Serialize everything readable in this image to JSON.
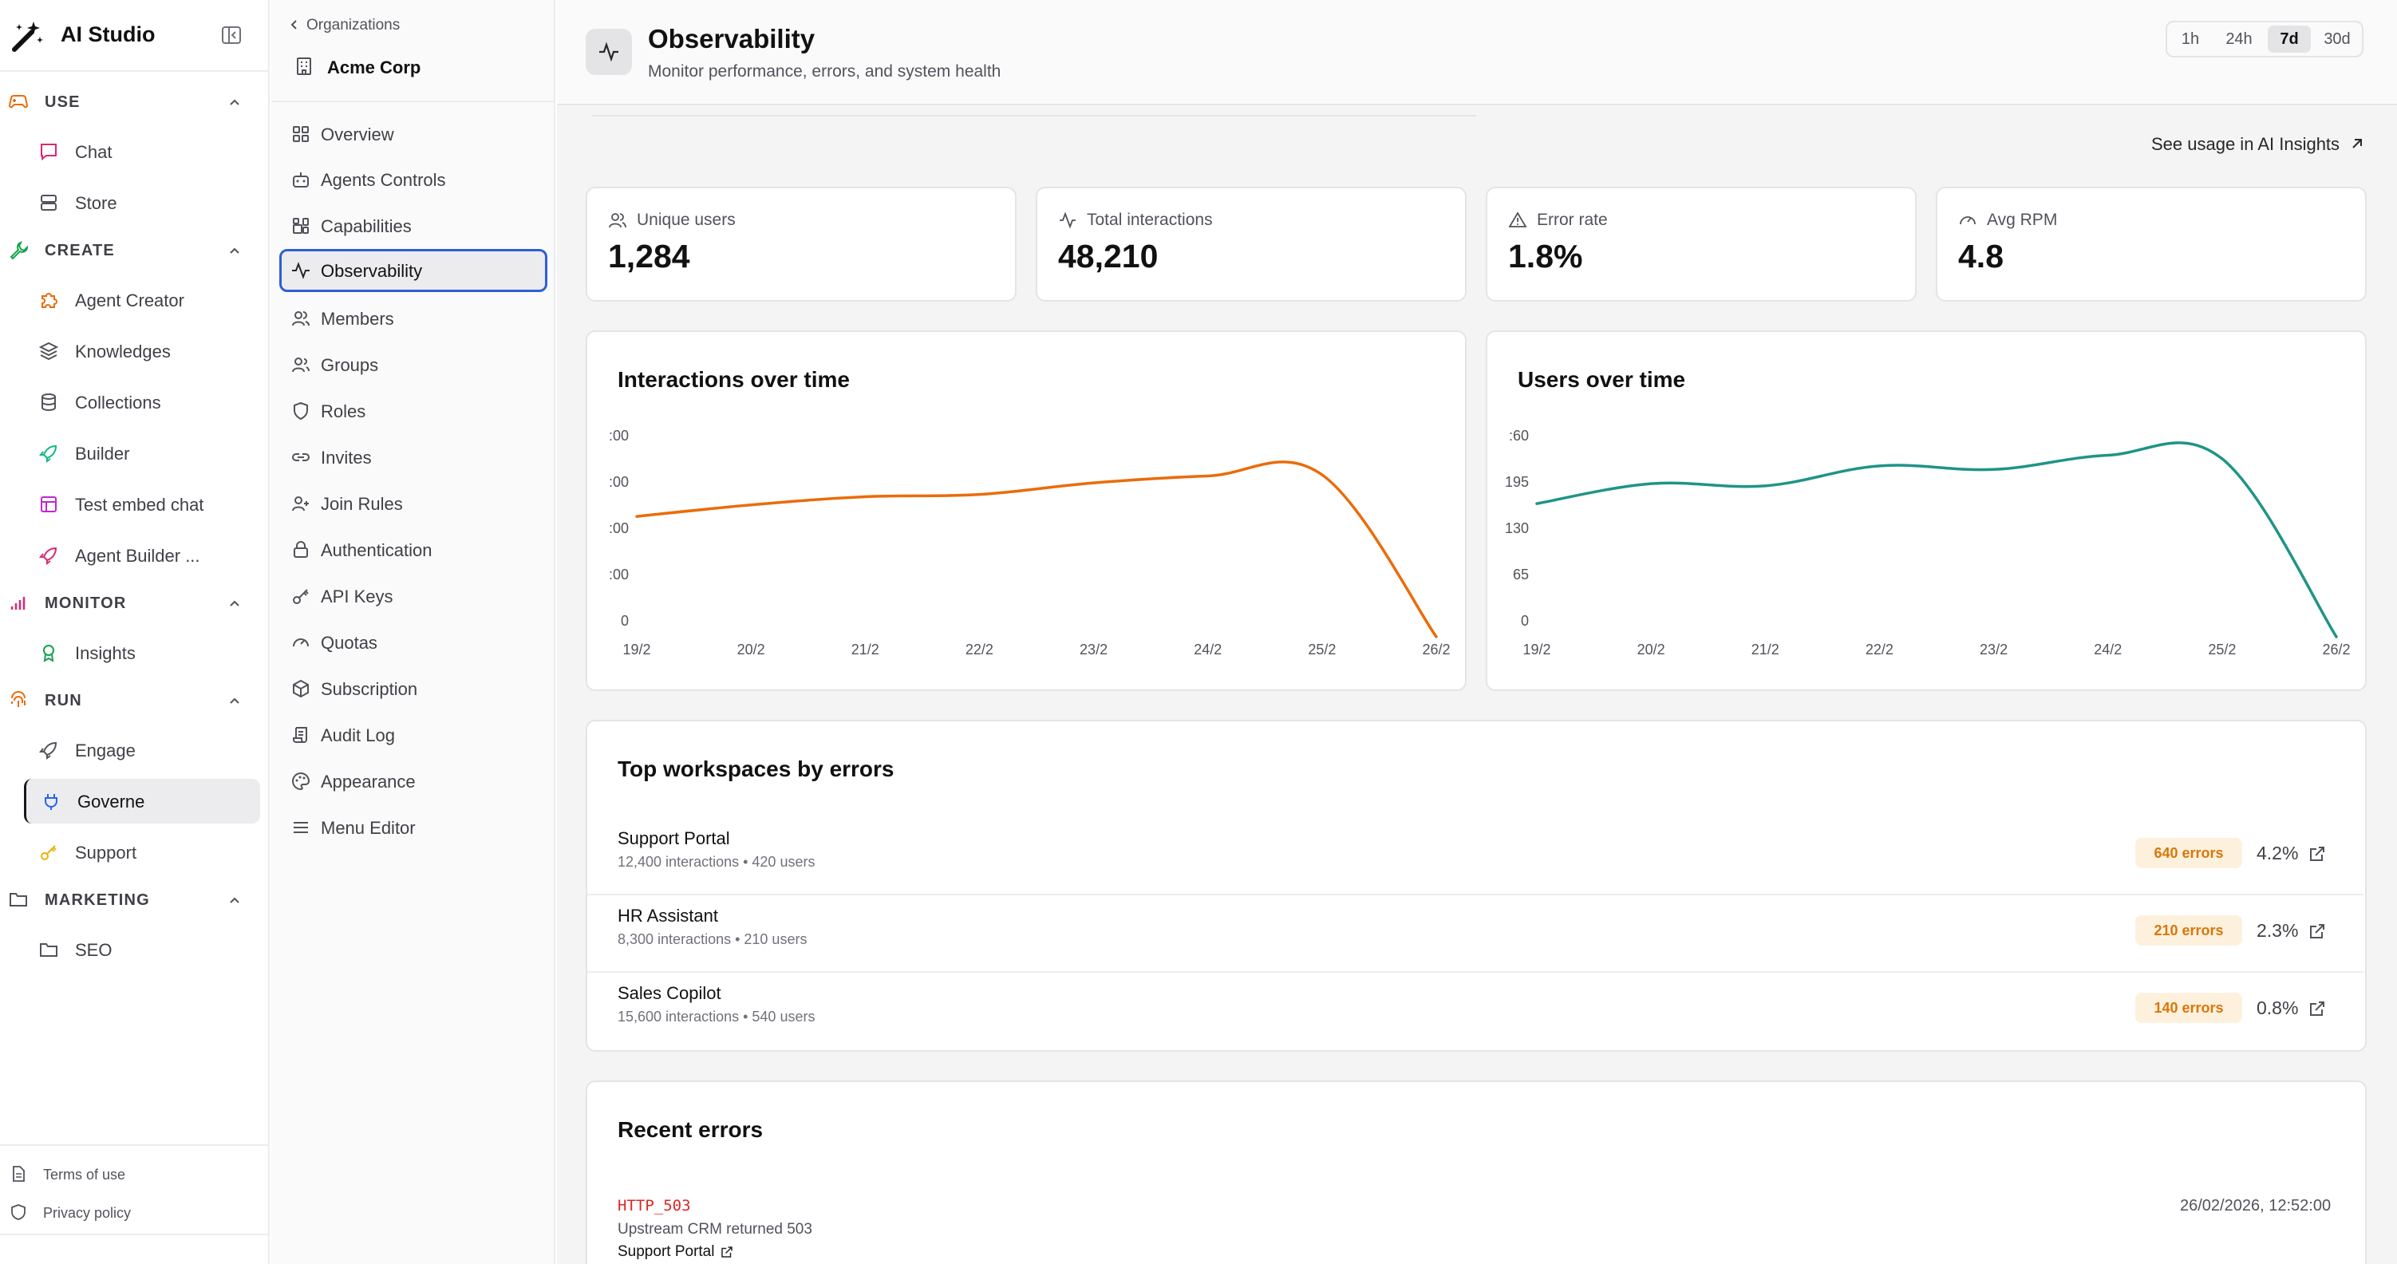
{
  "app": {
    "name": "AI Studio"
  },
  "sidebar": {
    "sections": [
      {
        "label": "USE",
        "items": [
          {
            "label": "Chat"
          },
          {
            "label": "Store"
          }
        ]
      },
      {
        "label": "CREATE",
        "items": [
          {
            "label": "Agent Creator"
          },
          {
            "label": "Knowledges"
          },
          {
            "label": "Collections"
          },
          {
            "label": "Builder"
          },
          {
            "label": "Test embed chat"
          },
          {
            "label": "Agent Builder ..."
          }
        ]
      },
      {
        "label": "MONITOR",
        "items": [
          {
            "label": "Insights"
          }
        ]
      },
      {
        "label": "RUN",
        "items": [
          {
            "label": "Engage"
          },
          {
            "label": "Governe"
          },
          {
            "label": "Support"
          }
        ]
      },
      {
        "label": "MARKETING",
        "items": [
          {
            "label": "SEO"
          }
        ]
      }
    ],
    "active_item": "Governe",
    "legal": {
      "terms": "Terms of use",
      "privacy": "Privacy policy"
    }
  },
  "org_nav": {
    "back_label": "Organizations",
    "org_name": "Acme Corp",
    "items": [
      {
        "label": "Overview"
      },
      {
        "label": "Agents Controls"
      },
      {
        "label": "Capabilities"
      },
      {
        "label": "Observability"
      },
      {
        "label": "Members"
      },
      {
        "label": "Groups"
      },
      {
        "label": "Roles"
      },
      {
        "label": "Invites"
      },
      {
        "label": "Join Rules"
      },
      {
        "label": "Authentication"
      },
      {
        "label": "API Keys"
      },
      {
        "label": "Quotas"
      },
      {
        "label": "Subscription"
      },
      {
        "label": "Audit Log"
      },
      {
        "label": "Appearance"
      },
      {
        "label": "Menu Editor"
      }
    ],
    "active_item": "Observability"
  },
  "header": {
    "title": "Observability",
    "subtitle": "Monitor performance, errors, and system health",
    "ranges": [
      "1h",
      "24h",
      "7d",
      "30d"
    ],
    "active_range": "7d"
  },
  "usage_link": "See usage in AI Insights",
  "kpis": [
    {
      "label": "Unique users",
      "value": "1,284",
      "icon": "users-icon"
    },
    {
      "label": "Total interactions",
      "value": "48,210",
      "icon": "activity-icon"
    },
    {
      "label": "Error rate",
      "value": "1.8%",
      "icon": "alert-triangle-icon"
    },
    {
      "label": "Avg RPM",
      "value": "4.8",
      "icon": "gauge-icon"
    }
  ],
  "chart_data": [
    {
      "type": "line",
      "title": "Interactions over time",
      "x": [
        "19/2",
        "20/2",
        "21/2",
        "22/2",
        "23/2",
        "24/2",
        "25/2",
        "26/2"
      ],
      "y_ticks": [
        ":00",
        ":00",
        ":00",
        ":00",
        "0"
      ],
      "ylim": [
        0,
        8000
      ],
      "series": [
        {
          "values": [
            5200,
            5700,
            6050,
            6150,
            6650,
            6950,
            7000,
            0
          ],
          "color": "#ea6c0a"
        }
      ],
      "grid": false
    },
    {
      "type": "line",
      "title": "Users over time",
      "x": [
        "19/2",
        "20/2",
        "21/2",
        "22/2",
        "23/2",
        "24/2",
        "25/2",
        "26/2"
      ],
      "y_ticks": [
        ":60",
        "195",
        "130",
        "65",
        "0"
      ],
      "ylim": [
        0,
        260
      ],
      "series": [
        {
          "values": [
            187,
            215,
            212,
            240,
            235,
            255,
            250,
            0
          ],
          "color": "#1f9486"
        }
      ],
      "grid": false
    }
  ],
  "workspaces": {
    "title": "Top workspaces by errors",
    "rows": [
      {
        "name": "Support Portal",
        "meta": "12,400 interactions • 420 users",
        "errors": "640 errors",
        "pct": "4.2%"
      },
      {
        "name": "HR Assistant",
        "meta": "8,300 interactions • 210 users",
        "errors": "210 errors",
        "pct": "2.3%"
      },
      {
        "name": "Sales Copilot",
        "meta": "15,600 interactions • 540 users",
        "errors": "140 errors",
        "pct": "0.8%"
      }
    ]
  },
  "recent_errors": {
    "title": "Recent errors",
    "items": [
      {
        "code": "HTTP_503",
        "message": "Upstream CRM returned 503",
        "workspace": "Support Portal",
        "time": "26/02/2026, 12:52:00"
      }
    ]
  },
  "colors": {
    "accent_orange": "#ea6c0a",
    "accent_teal": "#1f9486",
    "error_red": "#dc2626",
    "badge_bg": "#fdf1de",
    "active_border": "#2f5fd4"
  }
}
